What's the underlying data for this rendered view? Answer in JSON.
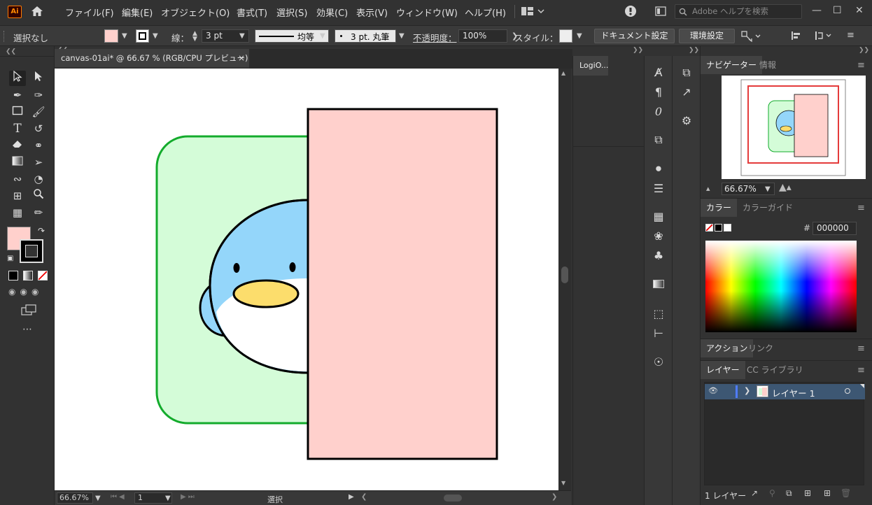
{
  "app": {
    "logo": "Ai"
  },
  "menu": {
    "items": [
      "ファイル(F)",
      "編集(E)",
      "オブジェクト(O)",
      "書式(T)",
      "選択(S)",
      "効果(C)",
      "表示(V)",
      "ウィンドウ(W)",
      "ヘルプ(H)"
    ],
    "search_placeholder": "Adobe ヘルプを検索"
  },
  "control_bar": {
    "selection": "選択なし",
    "stroke_label": "線：",
    "stroke_weight": "3 pt",
    "stroke_profile": "均等",
    "brush": "3 pt. 丸筆",
    "opacity_label": "不透明度：",
    "opacity_value": "100%",
    "style_label": "スタイル：",
    "doc_settings": "ドキュメント設定",
    "preferences": "環境設定"
  },
  "document": {
    "tab_title": "canvas-01ai* @ 66.67 % (RGB/CPU プレビュー)",
    "tab_close": "×"
  },
  "artwork": {
    "rounded_rect_fill": "#d4fcd8",
    "rounded_rect_stroke": "#13ab2c",
    "penguin_body": "#94d6fa",
    "beak": "#fcdd6c",
    "pink_rect_fill": "#ffd0cc",
    "pink_rect_stroke": "#000000"
  },
  "status_bar": {
    "zoom": "66.67%",
    "artboard": "1",
    "tool": "選択"
  },
  "panels": {
    "logi_tab": "LogiO...",
    "navigator_tab": "ナビゲーター",
    "info_tab": "情報",
    "nav_zoom": "66.67%",
    "color_tab": "カラー",
    "color_guide_tab": "カラーガイド",
    "hex_label": "#",
    "hex_value": "000000",
    "actions_tab": "アクション",
    "links_tab": "リンク",
    "layers_tab": "レイヤー",
    "cc_lib_tab": "CC ライブラリ",
    "layer_name": "レイヤー 1",
    "layer_count": "1 レイヤー"
  },
  "colors": {
    "fill_swatch": "#ffd0cc",
    "ui_bg": "#323232",
    "layer_highlight": "#3d5773"
  }
}
